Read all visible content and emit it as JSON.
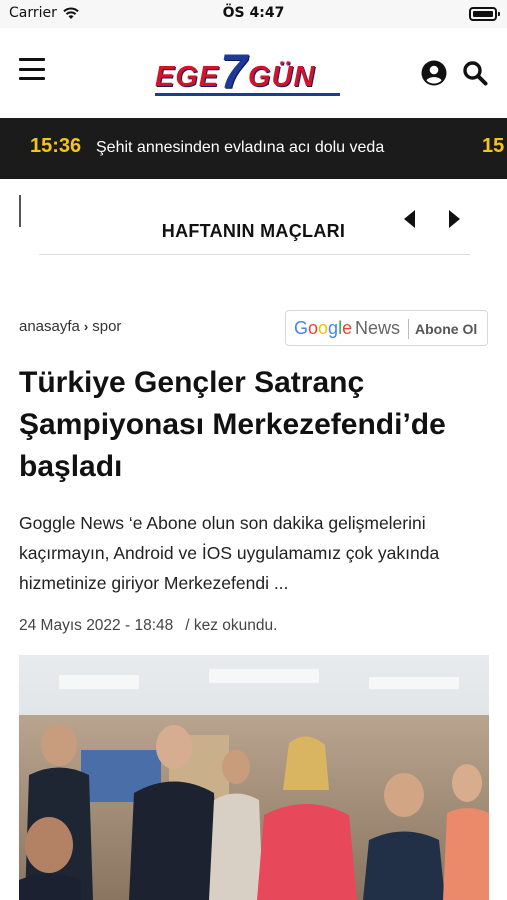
{
  "status_bar": {
    "carrier": "Carrier",
    "time": "ÖS 4:47"
  },
  "header": {
    "logo": {
      "part1": "EGE",
      "part2": "7",
      "part3": "GÜN"
    },
    "icons": [
      "menu-icon",
      "user-icon",
      "search-icon"
    ]
  },
  "ticker": {
    "time": "15:36",
    "text": "Şehit annesinden evladına acı dolu veda",
    "next_time": "15"
  },
  "matches": {
    "title": "HAFTANIN MAÇLARI"
  },
  "breadcrumb": {
    "home": "anasayfa",
    "separator": "›",
    "category": "spor"
  },
  "google_news": {
    "google": "Google",
    "news": "News",
    "subscribe": "Abone Ol"
  },
  "article": {
    "headline": "Türkiye Gençler Satranç Şampiyonası Merkezefendi’de başladı",
    "summary": "Goggle News ‘e Abone olun son dakika gelişmelerini kaçırmayın, Android ve İOS uygulamamız çok yakında hizmetinize giriyor Merkezefendi ...",
    "date": "24 Mayıs 2022 - 18:48",
    "reads": "/ kez okundu."
  },
  "colors": {
    "brand_red": "#d0142a",
    "brand_blue": "#1d3a9a",
    "ticker_bg": "#1b1b1b",
    "ticker_time": "#f5c518"
  }
}
